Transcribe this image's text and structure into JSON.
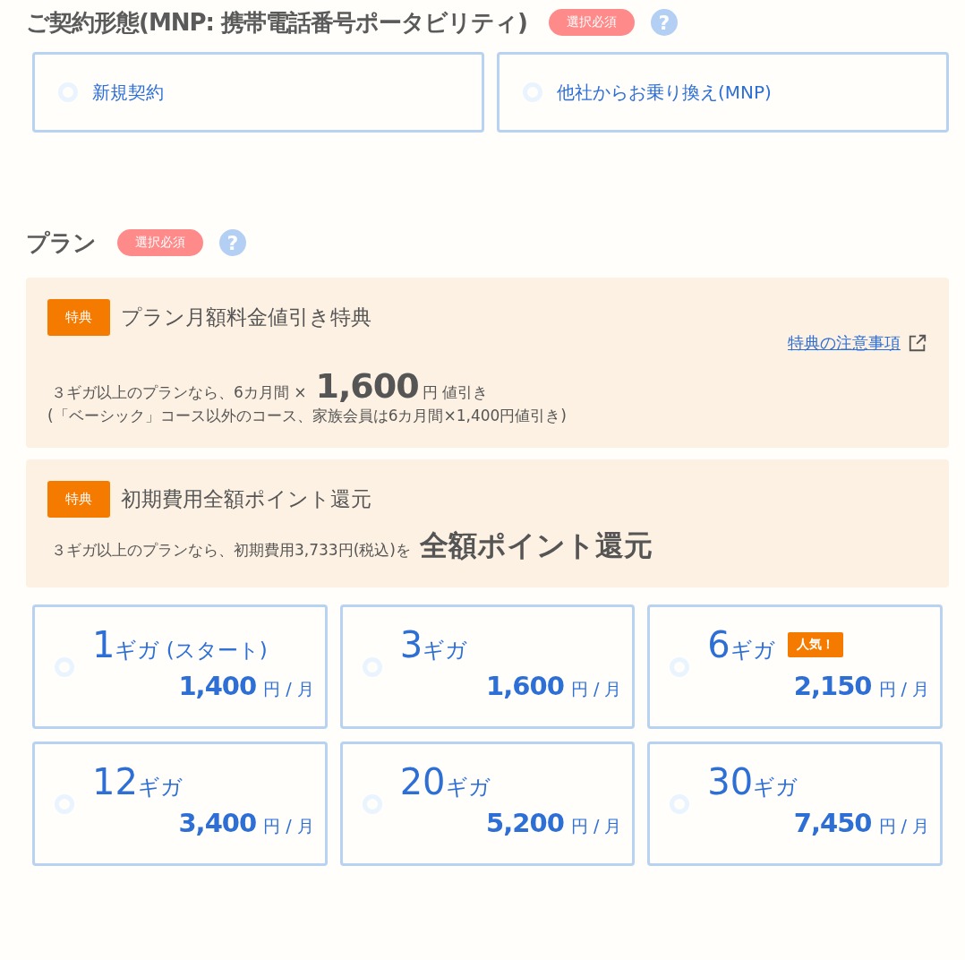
{
  "contract": {
    "title": "ご契約形態(MNP: 携帯電話番号ポータビリティ)",
    "badge": "選択必須",
    "help": "?",
    "options": [
      {
        "label": "新規契約",
        "selected": false
      },
      {
        "label": "他社からお乗り換え(MNP)",
        "selected": false
      }
    ]
  },
  "plan": {
    "title": "プラン",
    "badge": "選択必須",
    "help": "?",
    "perks": [
      {
        "tag": "特典",
        "title": "プラン月額料金値引き特典",
        "link": "特典の注意事項",
        "lead": "３ギガ以上のプランなら、6カ月間 ×",
        "highlight": "1,600",
        "tail": "円 値引き",
        "note": "(「ベーシック」コース以外のコース、家族会員は6カ月間×1,400円値引き)"
      },
      {
        "tag": "特典",
        "title": "初期費用全額ポイント還元",
        "lead": "３ギガ以上のプランなら、初期費用3,733円(税込)を",
        "highlight": "全額ポイント還元"
      }
    ],
    "options": [
      {
        "amount": "1",
        "unit": "ギガ",
        "note": "(スタート)",
        "price": "1,400",
        "per": "円 / 月",
        "selected": false
      },
      {
        "amount": "3",
        "unit": "ギガ",
        "price": "1,600",
        "per": "円 / 月",
        "selected": false
      },
      {
        "amount": "6",
        "unit": "ギガ",
        "badge": "人気！",
        "price": "2,150",
        "per": "円 / 月",
        "selected": false
      },
      {
        "amount": "12",
        "unit": "ギガ",
        "price": "3,400",
        "per": "円 / 月",
        "selected": false
      },
      {
        "amount": "20",
        "unit": "ギガ",
        "price": "5,200",
        "per": "円 / 月",
        "selected": false
      },
      {
        "amount": "30",
        "unit": "ギガ",
        "price": "7,450",
        "per": "円 / 月",
        "selected": false
      }
    ]
  }
}
